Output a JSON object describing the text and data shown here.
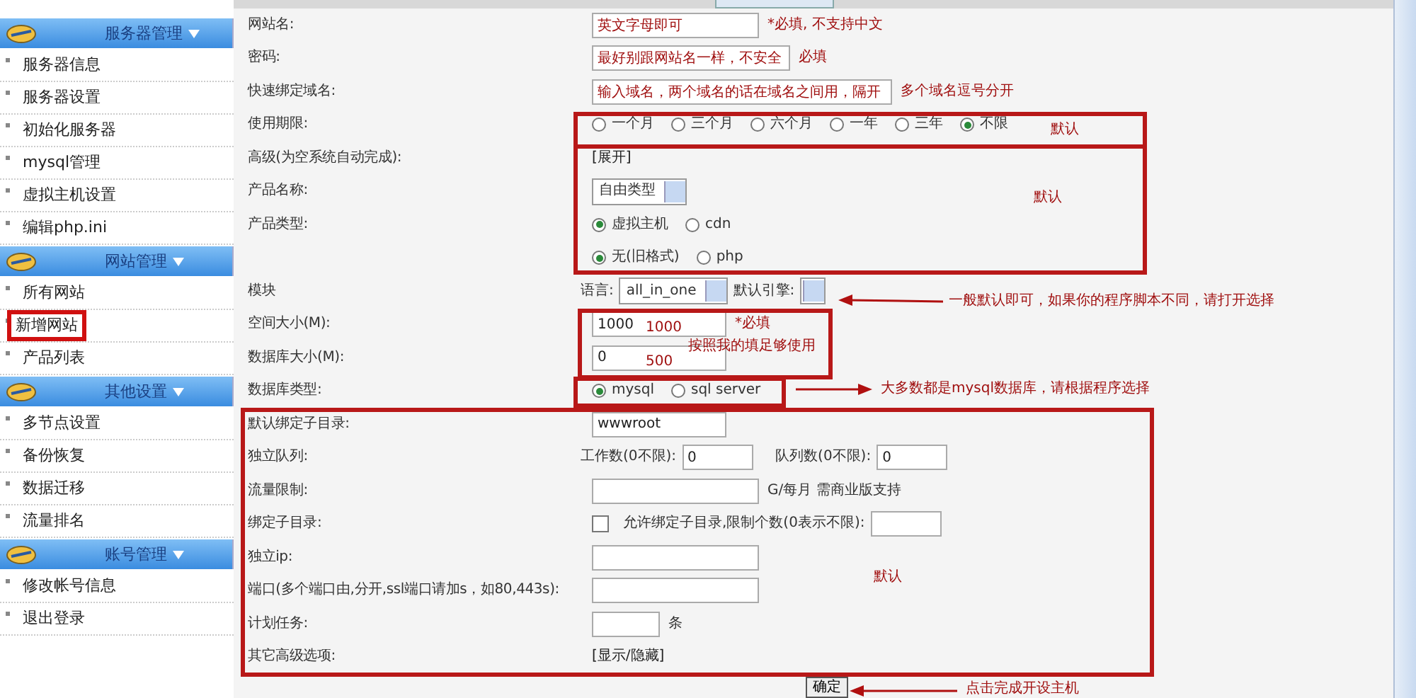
{
  "sidebar": {
    "groups": [
      {
        "title": "服务器管理",
        "items": [
          {
            "label": "服务器信息",
            "selected": false
          },
          {
            "label": "服务器设置",
            "selected": false
          },
          {
            "label": "初始化服务器",
            "selected": false
          },
          {
            "label": "mysql管理",
            "selected": false
          },
          {
            "label": "虚拟主机设置",
            "selected": false
          },
          {
            "label": "编辑php.ini",
            "selected": false
          }
        ]
      },
      {
        "title": "网站管理",
        "items": [
          {
            "label": "所有网站",
            "selected": false
          },
          {
            "label": "新增网站",
            "selected": true
          },
          {
            "label": "产品列表",
            "selected": false
          }
        ]
      },
      {
        "title": "其他设置",
        "items": [
          {
            "label": "多节点设置",
            "selected": false
          },
          {
            "label": "备份恢复",
            "selected": false
          },
          {
            "label": "数据迁移",
            "selected": false
          },
          {
            "label": "流量排名",
            "selected": false
          }
        ]
      },
      {
        "title": "账号管理",
        "items": [
          {
            "label": "修改帐号信息",
            "selected": false
          },
          {
            "label": "退出登录",
            "selected": false
          }
        ]
      }
    ]
  },
  "form": {
    "rows": [
      {
        "kind": "input",
        "label": "网站名:",
        "value": "英文字母即可",
        "note": "*必填, 不支持中文",
        "red": true
      },
      {
        "kind": "input",
        "label": "密码:",
        "value": "最好别跟网站名一样，不安全",
        "note": "必填",
        "red": true
      },
      {
        "kind": "input",
        "label": "快速绑定域名:",
        "value": "输入域名，两个域名的话在域名之间用，隔开",
        "note": "多个域名逗号分开",
        "red": true,
        "wide": true
      },
      {
        "kind": "radios",
        "label": "使用期限:",
        "options": [
          {
            "label": "一个月",
            "selected": false
          },
          {
            "label": "三个月",
            "selected": false
          },
          {
            "label": "六个月",
            "selected": false
          },
          {
            "label": "一年",
            "selected": false
          },
          {
            "label": "三年",
            "selected": false
          },
          {
            "label": "不限",
            "selected": true
          }
        ]
      },
      {
        "kind": "link",
        "label": "高级(为空系统自动完成):",
        "text": "[展开]"
      },
      {
        "kind": "select",
        "label": "产品名称:",
        "value": "自由类型"
      },
      {
        "kind": "radios",
        "label": "产品类型:",
        "options": [
          {
            "label": "虚拟主机",
            "selected": true
          },
          {
            "label": "cdn",
            "selected": false
          }
        ]
      },
      {
        "kind": "radios",
        "options": [
          {
            "label": "无(旧格式)",
            "selected": true
          },
          {
            "label": "php",
            "selected": false
          }
        ]
      },
      {
        "kind": "module",
        "label": "模块",
        "lang_label": "语言:",
        "lang_value": "all_in_one",
        "engine_label": "默认引擎:"
      },
      {
        "kind": "input",
        "label": "空间大小(M):",
        "value": "1000",
        "note": "*必填",
        "red_note": true
      },
      {
        "kind": "input",
        "label": "数据库大小(M):",
        "value": "0"
      },
      {
        "kind": "radios",
        "label": "数据库类型:",
        "options": [
          {
            "label": "mysql",
            "selected": true
          },
          {
            "label": "sql server",
            "selected": false
          }
        ]
      },
      {
        "kind": "input",
        "label": "默认绑定子目录:",
        "value": "wwwroot"
      },
      {
        "kind": "pair",
        "label": "独立队列:",
        "first_label": "工作数(0不限):",
        "first_value": "0",
        "second_label": "队列数(0不限):",
        "second_value": "0"
      },
      {
        "kind": "input",
        "label": "流量限制:",
        "note": "G/每月  需商业版支持",
        "wide_short": true
      },
      {
        "kind": "checkbox",
        "label": "绑定子目录:",
        "checked": false,
        "text": "允许绑定子目录,限制个数(0表示不限):"
      },
      {
        "kind": "input",
        "label": "独立ip:",
        "wide_short": true
      },
      {
        "kind": "input",
        "label": "端口(多个端口由,分开,ssl端口请加s，如80,443s):",
        "wide_short": true
      },
      {
        "kind": "input",
        "label": "计划任务:",
        "note": "条",
        "short": true
      },
      {
        "kind": "link",
        "label": "其它高级选项:",
        "text": "[显示/隐藏]"
      }
    ],
    "submit": "确定"
  },
  "annotations": [
    {
      "text": "默认"
    },
    {
      "text": "默认"
    },
    {
      "text": "一般默认即可，如果你的程序脚本不同，请打开选择"
    },
    {
      "text": "1000"
    },
    {
      "text": "按照我的填足够使用"
    },
    {
      "text": "500"
    },
    {
      "text": "大多数都是mysql数据库，请根据程序选择"
    },
    {
      "text": "默认"
    },
    {
      "text": "点击完成开设主机"
    }
  ]
}
